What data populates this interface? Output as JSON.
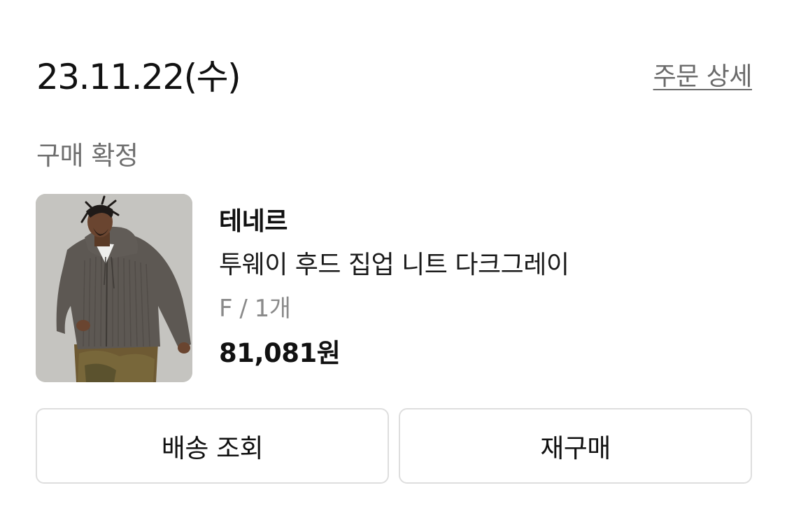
{
  "order": {
    "date": "23.11.22(수)",
    "detail_link": "주문 상세",
    "status": "구매 확정"
  },
  "product": {
    "image_icon": "product-photo",
    "brand": "테네르",
    "name": "투웨이 후드 집업 니트 다크그레이",
    "option": "F / 1개",
    "price": "81,081원"
  },
  "actions": {
    "track_delivery": "배송 조회",
    "reorder": "재구매"
  },
  "colors": {
    "text_primary": "#111111",
    "text_secondary": "#6e6e6e",
    "text_muted": "#8a8a8a",
    "border": "#dedede"
  }
}
